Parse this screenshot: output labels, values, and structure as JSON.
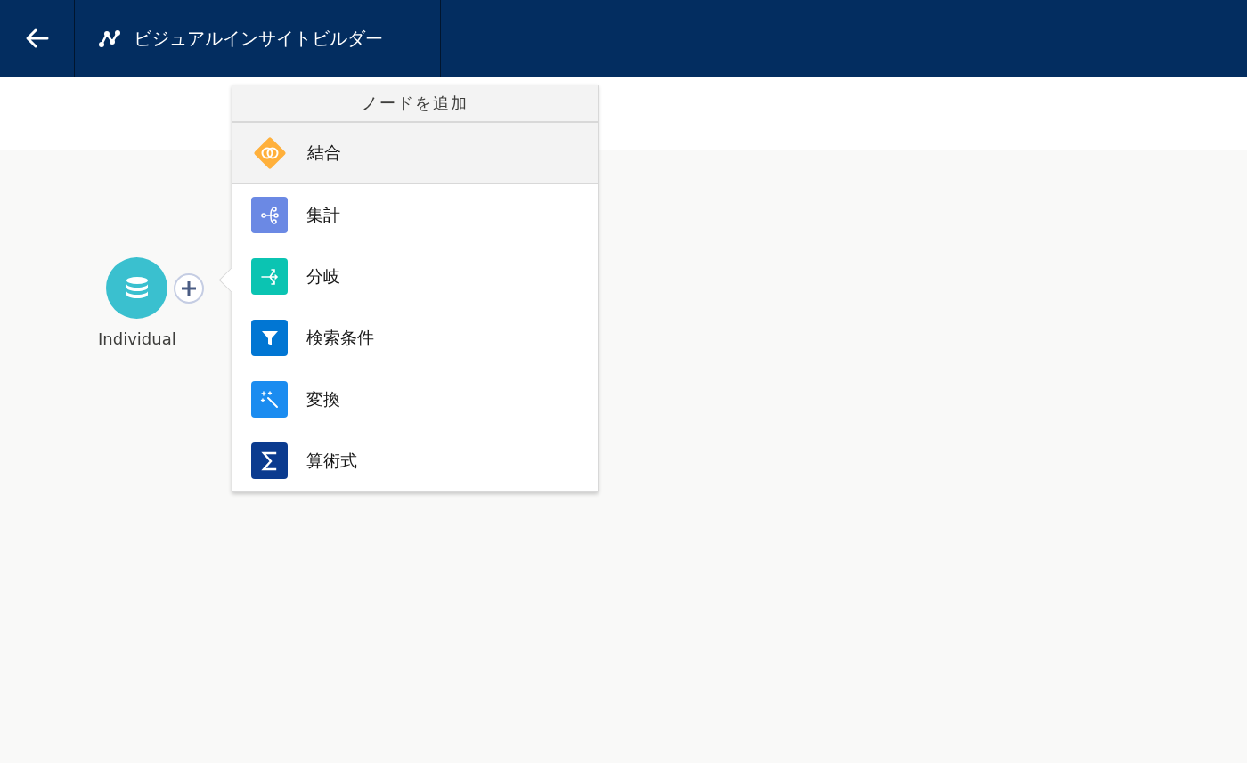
{
  "header": {
    "title": "ビジュアルインサイトビルダー"
  },
  "canvas": {
    "nodes": [
      {
        "label": "Individual",
        "kind": "source"
      }
    ]
  },
  "add_node_menu": {
    "title": "ノードを追加",
    "items": [
      {
        "label": "結合",
        "kind": "join",
        "selected": true
      },
      {
        "label": "集計",
        "kind": "aggregate",
        "selected": false
      },
      {
        "label": "分岐",
        "kind": "branch",
        "selected": false
      },
      {
        "label": "検索条件",
        "kind": "filter",
        "selected": false
      },
      {
        "label": "変換",
        "kind": "transform",
        "selected": false
      },
      {
        "label": "算術式",
        "kind": "formula",
        "selected": false
      }
    ]
  }
}
